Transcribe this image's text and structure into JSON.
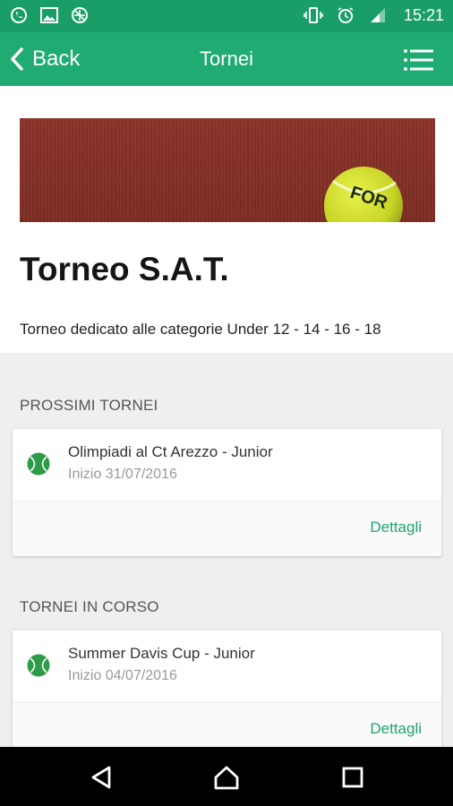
{
  "status_bar": {
    "time": "15:21",
    "left_icons": [
      "whatsapp-icon",
      "image-icon",
      "no-sync-icon"
    ],
    "right_icons": [
      "vibrate-icon",
      "alarm-icon",
      "signal-icon"
    ]
  },
  "toolbar": {
    "back_label": "Back",
    "title": "Tornei"
  },
  "header": {
    "title": "Torneo S.A.T.",
    "description": "Torneo dedicato alle categorie Under 12 - 14 - 16 - 18"
  },
  "sections": [
    {
      "label": "PROSSIMI TORNEI",
      "items": [
        {
          "title": "Olimpiadi al Ct Arezzo - Junior",
          "subtitle": "Inizio 31/07/2016",
          "action": "Dettagli"
        }
      ]
    },
    {
      "label": "TORNEI IN CORSO",
      "items": [
        {
          "title": "Summer Davis Cup - Junior",
          "subtitle": "Inizio 04/07/2016",
          "action": "Dettagli"
        }
      ]
    }
  ],
  "colors": {
    "primary": "#1fab71",
    "status_bar": "#1a9e67",
    "accent_link": "#1fa66b",
    "ball_green": "#2e9b48"
  }
}
